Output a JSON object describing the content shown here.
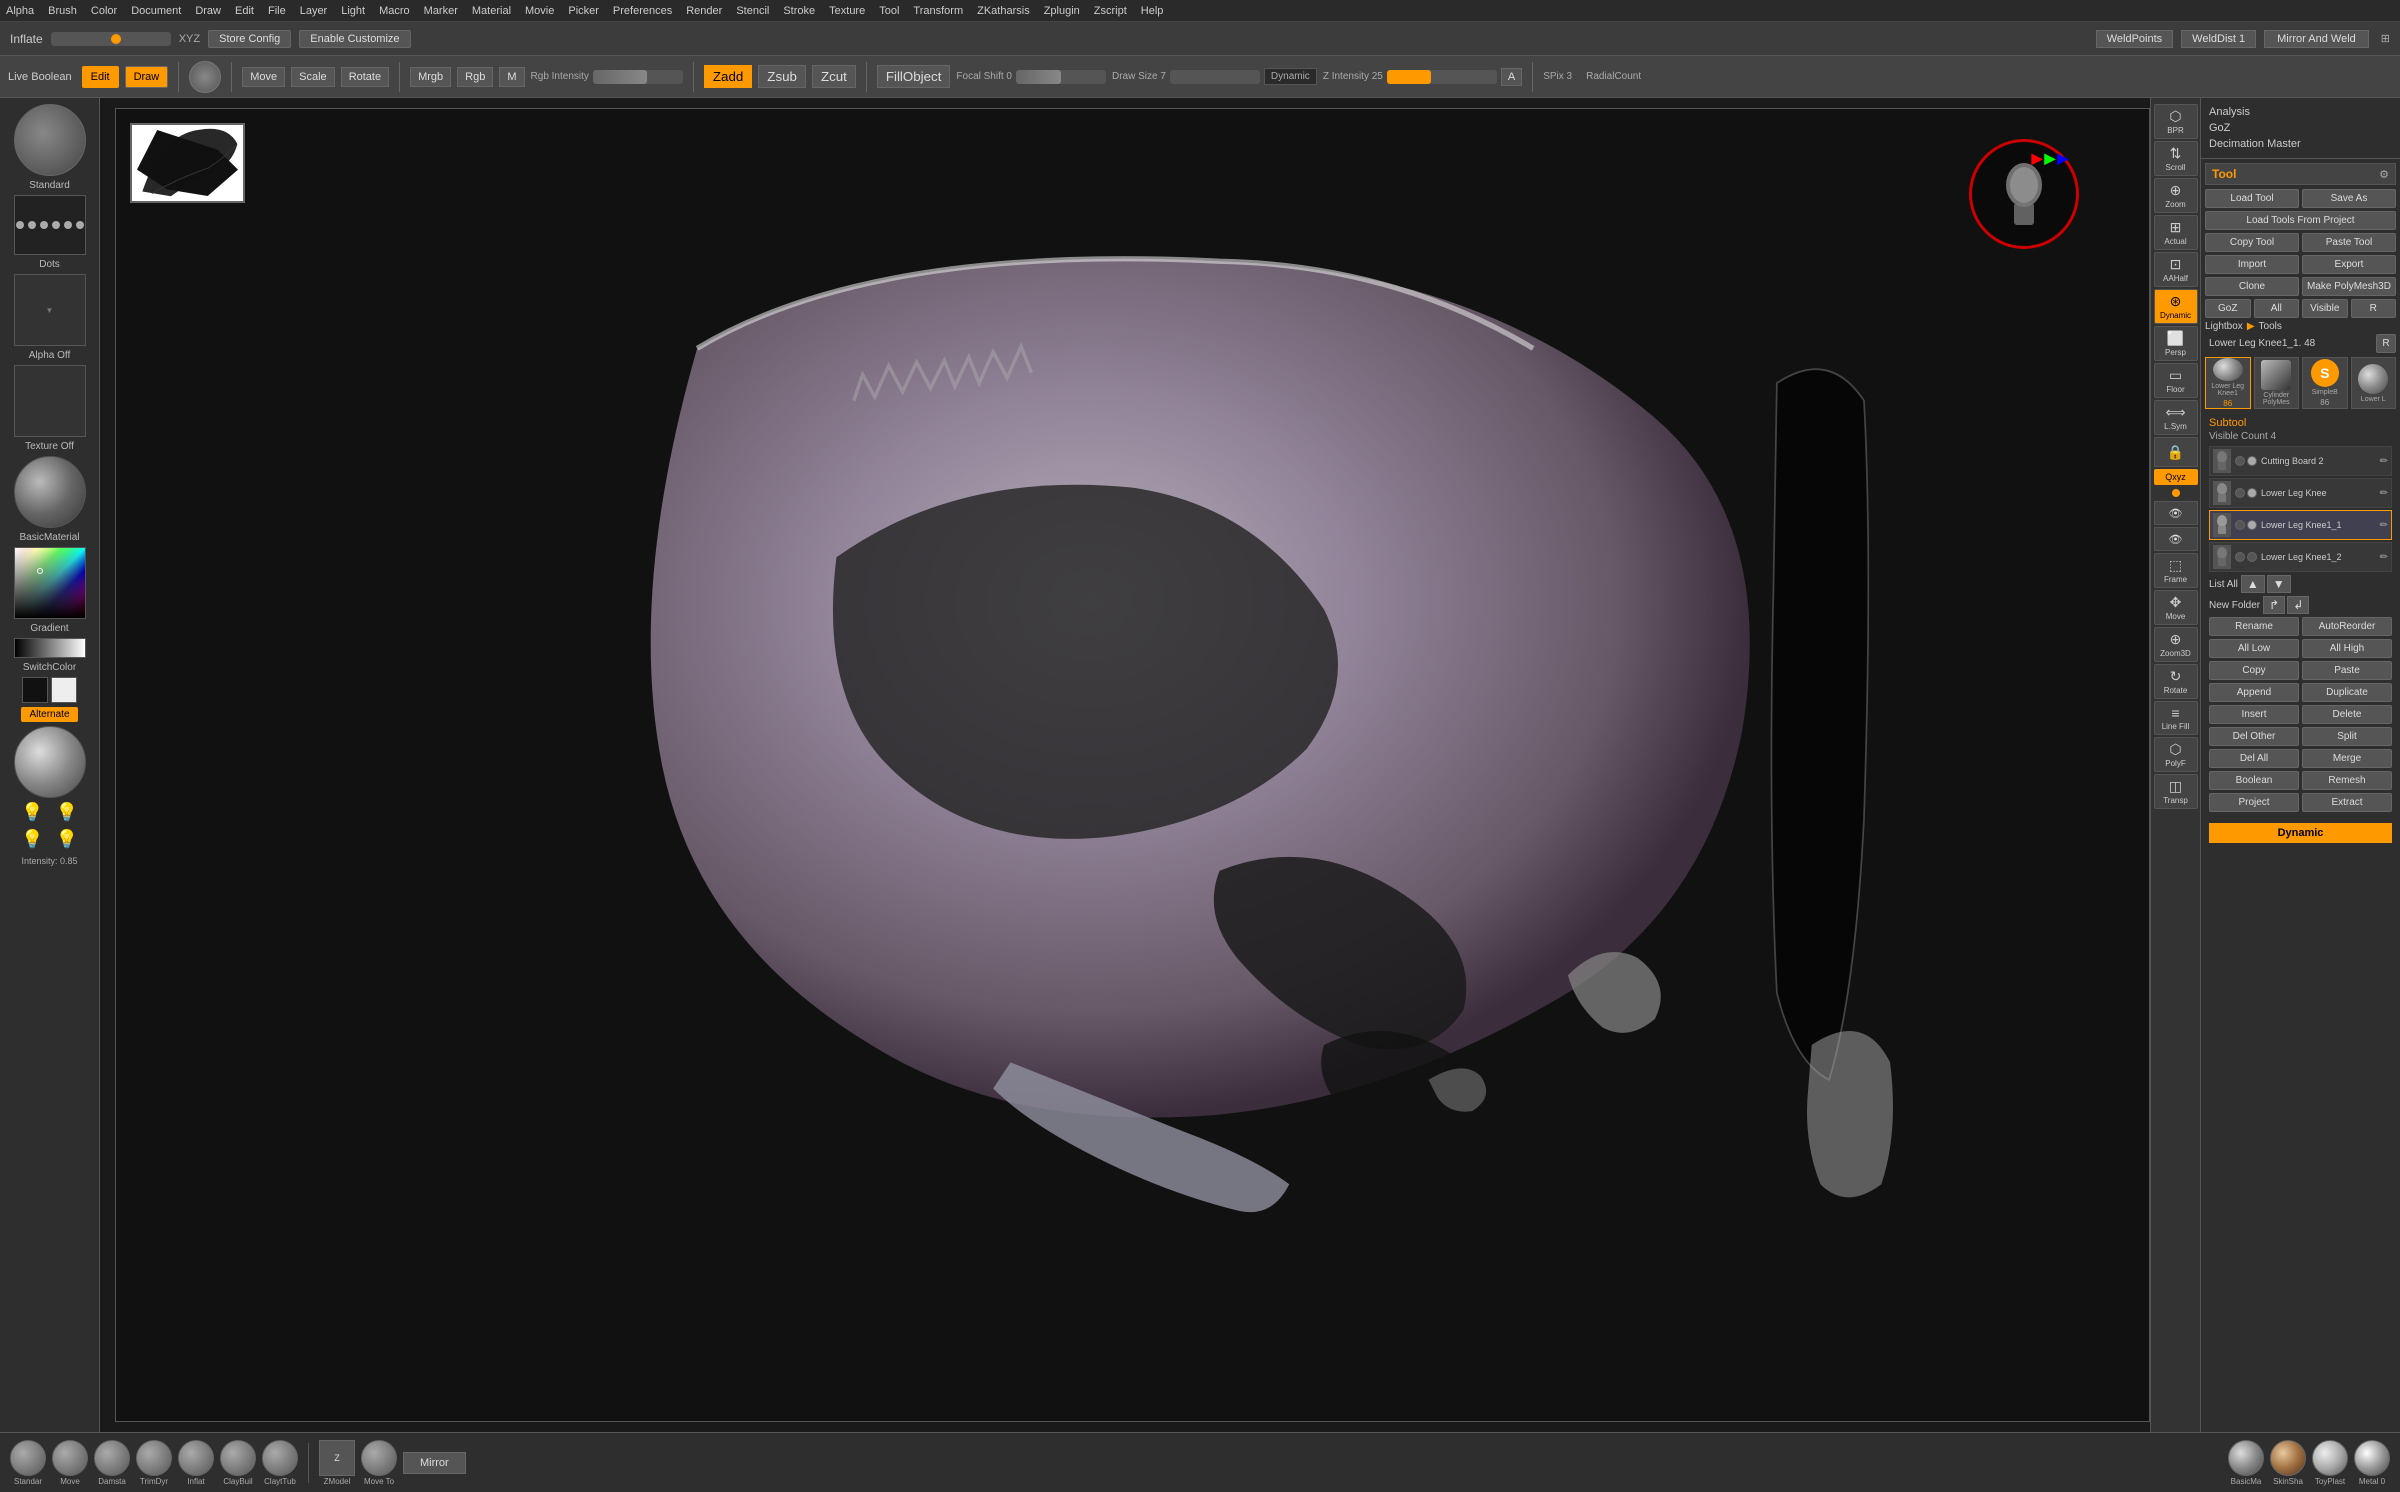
{
  "menubar": {
    "items": [
      "Alpha",
      "Brush",
      "Color",
      "Document",
      "Draw",
      "Edit",
      "File",
      "Layer",
      "Light",
      "Macro",
      "Marker",
      "Material",
      "Movie",
      "Picker",
      "Preferences",
      "Render",
      "Stencil",
      "Stroke",
      "Texture",
      "Tool",
      "Transform",
      "ZKatharsis",
      "Zplugin",
      "Zscript",
      "Help"
    ]
  },
  "secondary_toolbar": {
    "inflate_label": "Inflate",
    "xyz_label": "XYZ",
    "store_config": "Store Config",
    "enable_customize": "Enable Customize",
    "weld_points": "WeldPoints",
    "weld_dist": "WeldDist 1",
    "mirror_and_weld": "Mirror And Weld"
  },
  "main_toolbar": {
    "live_boolean": "Live Boolean",
    "edit": "Edit",
    "draw": "Draw",
    "move": "Move",
    "scale": "Scale",
    "rotate": "Rotate",
    "mrgb": "Mrgb",
    "rgb": "Rgb",
    "m": "M",
    "rgb_intensity": "Rgb Intensity",
    "zadd": "Zadd",
    "zsub": "Zsub",
    "zcut": "Zcut",
    "fill_object": "FillObject",
    "focal_shift": "Focal Shift 0",
    "draw_size": "Draw Size 7",
    "dynamic": "Dynamic",
    "a": "A",
    "spix": "SPix 3",
    "radial_count": "RadialCount"
  },
  "left_panel": {
    "brush_name": "Standard",
    "dots_name": "Dots",
    "alpha_name": "Alpha Off",
    "texture_name": "Texture Off",
    "material_name": "BasicMaterial",
    "gradient_name": "Gradient",
    "switch_color_name": "SwitchColor",
    "alternate": "Alternate",
    "intensity_label": "Intensity: 0.85"
  },
  "right_panel": {
    "analysis": "Analysis",
    "goz": "GoZ",
    "decimation_master": "Decimation Master",
    "tool_title": "Tool",
    "load_tool": "Load Tool",
    "save_as": "Save As",
    "load_tools_from_project": "Load Tools From Project",
    "copy_tool": "Copy Tool",
    "paste_tool": "Paste Tool",
    "import": "Import",
    "export": "Export",
    "clone": "Clone",
    "make_polymesh3d": "Make PolyMesh3D",
    "goz_btn": "GoZ",
    "all": "All",
    "visible": "Visible",
    "r": "R",
    "lightbox": "Lightbox",
    "tools": "Tools",
    "current_tool": "Lower Leg Knee1_1. 48",
    "r2": "R",
    "subtool_header": "Subtool",
    "visible_count": "Visible Count 4",
    "cutting_board_2": "Cutting Board 2",
    "lower_leg_knee": "Lower Leg Knee",
    "lower_leg_knee1_1": "Lower Leg Knee1_1",
    "lower_leg_knee1_2": "Lower Leg Knee1_2",
    "list_all": "List All",
    "new_folder": "New Folder",
    "rename": "Rename",
    "auto_reorder": "AutoReorder",
    "all_low": "All Low",
    "all_high": "All High",
    "copy": "Copy",
    "paste": "Paste",
    "append": "Append",
    "duplicate": "Duplicate",
    "insert": "Insert",
    "delete": "Delete",
    "del_other": "Del Other",
    "split": "Split",
    "del_all": "Del All",
    "merge": "Merge",
    "boolean": "Boolean",
    "remesh": "Remesh",
    "project": "Project",
    "extract": "Extract",
    "dynamic_bottom": "Dynamic"
  },
  "bottom_bar": {
    "brushes": [
      "Standar",
      "Move",
      "Damsta",
      "TrimDyr",
      "Inflat",
      "ClayBuil",
      "ClaytTub"
    ],
    "zmodeler": "ZModel",
    "move_topological": "Move To",
    "mirror": "Mirror",
    "materials": [
      "BasicMa",
      "SkinSha",
      "ToyPlast",
      "Metal 0"
    ]
  },
  "right_icons": {
    "bpr": "BPR",
    "scroll": "Scroll",
    "zoom": "Zoom",
    "actual": "Actual",
    "aahalf": "AAHalf",
    "dynamic": "Dynamic",
    "persp": "Persp",
    "floor": "Floor",
    "lsym": "L.Sym",
    "lock_icon": "🔒",
    "qxyz": "Qxyz",
    "eye_icon": "👁",
    "eye2_icon": "👁",
    "frame": "Frame",
    "move": "Move",
    "zoom3d": "Zoom3D",
    "rotate": "Rotate",
    "line_fill": "Line Fill",
    "polyf": "PolyF",
    "transp": "Transp"
  }
}
